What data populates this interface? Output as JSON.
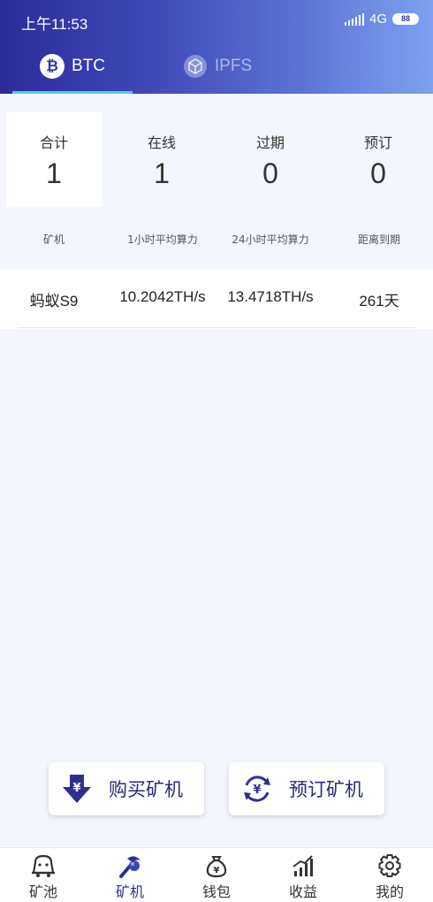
{
  "status_bar": {
    "time": "上午11:53",
    "network": "4G",
    "battery": "88"
  },
  "tabs": [
    {
      "label": "BTC",
      "icon": "btc-coin-icon",
      "active": true
    },
    {
      "label": "IPFS",
      "icon": "ipfs-cube-icon",
      "active": false
    }
  ],
  "stats": [
    {
      "label": "合计",
      "value": "1"
    },
    {
      "label": "在线",
      "value": "1"
    },
    {
      "label": "过期",
      "value": "0"
    },
    {
      "label": "预订",
      "value": "0"
    }
  ],
  "table": {
    "columns": [
      "矿机",
      "1小时平均算力",
      "24小时平均算力",
      "距离到期"
    ],
    "rows": [
      [
        "蚂蚁S9",
        "10.2042TH/s",
        "13.4718TH/s",
        "261天"
      ]
    ]
  },
  "actions": {
    "buy_label": "购买矿机",
    "reserve_label": "预订矿机"
  },
  "nav": [
    {
      "label": "矿池",
      "icon": "pool-cart-icon"
    },
    {
      "label": "矿机",
      "icon": "pickaxe-icon"
    },
    {
      "label": "钱包",
      "icon": "money-bag-icon"
    },
    {
      "label": "收益",
      "icon": "bar-chart-icon"
    },
    {
      "label": "我的",
      "icon": "gear-icon"
    }
  ],
  "colors": {
    "primary": "#2d2f8f",
    "accent": "#58c8ee",
    "background": "#f3f6fc"
  }
}
